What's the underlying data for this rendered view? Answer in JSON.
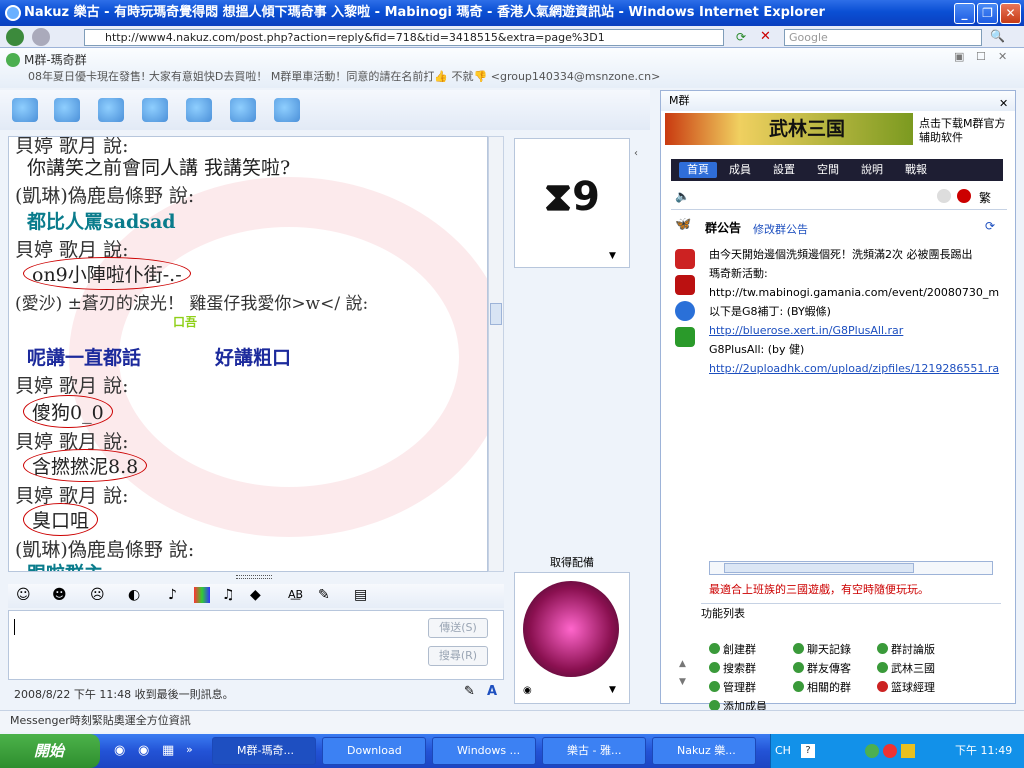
{
  "ie": {
    "title": "Nakuz 樂古 - 有時玩瑪奇覺得悶 想搵人傾下瑪奇事 入黎啦 - Mabinogi 瑪奇 - 香港人氣網遊資訊站 - Windows Internet Explorer",
    "url": "http://www4.nakuz.com/post.php?action=reply&fid=718&tid=3418515&extra=page%3D1",
    "search_placeholder": "Google"
  },
  "messenger": {
    "title": "M群-瑪奇群",
    "subtitle": "08年夏日優卡現在發售! 大家有意姐快D去買啦！ M群單車活動！同意的請在名前打👍 不就👎 <group140334@msnzone.cn>",
    "chat": [
      {
        "kind": "name",
        "text": "貝婷 歌月 說:"
      },
      {
        "kind": "msg",
        "text": "你講笑之前會同人講 我講笑啦?"
      },
      {
        "kind": "name",
        "text": "(凱琳)偽鹿島條野 說:"
      },
      {
        "kind": "msg",
        "text": "都比人罵sadsad"
      },
      {
        "kind": "name",
        "text": "貝婷 歌月 說:"
      },
      {
        "kind": "msg",
        "text": "on9小陣啦仆街-.-"
      },
      {
        "kind": "name",
        "text": "(愛沙) ±蒼刃的淚光！ 雞蛋仔我愛你>w</ 說:"
      },
      {
        "kind": "msg",
        "text": "呢講一直都話"
      },
      {
        "kind": "msg2",
        "text": "好講粗口"
      },
      {
        "kind": "name",
        "text": "貝婷 歌月 說:"
      },
      {
        "kind": "msg",
        "text": "傻狗0_0"
      },
      {
        "kind": "name",
        "text": "貝婷 歌月 說:"
      },
      {
        "kind": "msg",
        "text": "含撚撚泥8.8"
      },
      {
        "kind": "name",
        "text": "貝婷 歌月 說:"
      },
      {
        "kind": "msg",
        "text": "臭口咀"
      },
      {
        "kind": "name",
        "text": "(凱琳)偽鹿島條野 說:"
      },
      {
        "kind": "msg",
        "text": "跟啦群主"
      }
    ],
    "sticker_text": "口吾",
    "send_button": "傳送(S)",
    "search_button": "搜尋(R)",
    "status": "2008/8/22 下午 11:48 收到最後一則訊息。",
    "display_pic_label": "取得配備",
    "footer": "Messenger時刻緊貼奧運全方位資訊"
  },
  "panel": {
    "header": "M群",
    "banner_text": "武林三国",
    "download_text": "点击下载M群官方辅助软件",
    "tabs": [
      "首頁",
      "成員",
      "設置",
      "空間",
      "說明",
      "戰報"
    ],
    "notice_title": "群公告",
    "notice_edit": "修改群公告",
    "notice_lines": [
      {
        "text": "由今天開始邊個洗頻邊個死！洗頻滿2次 必被團長踢出",
        "link": false
      },
      {
        "text": "瑪奇新活動:",
        "link": false
      },
      {
        "text": "http://tw.mabinogi.gamania.com/event/20080730_m",
        "link": false
      },
      {
        "text": "以下是G8補丁: (BY蝦條)",
        "link": false
      },
      {
        "text": "http://bluerose.xert.in/G8PlusAll.rar",
        "link": true
      },
      {
        "text": "G8PlusAll: (by 健)",
        "link": false
      },
      {
        "text": "http://2uploadhk.com/upload/zipfiles/1219286551.ra",
        "link": true
      }
    ],
    "promo": "最適合上班族的三國遊戲，有空時隨便玩玩。",
    "functions_title": "功能列表",
    "functions": [
      "創建群",
      "聊天記錄",
      "群討論版",
      "搜索群",
      "群友傳客",
      "武林三國",
      "管理群",
      "相關的群",
      "篮球經理",
      "添加成員"
    ]
  },
  "taskbar": {
    "start": "開始",
    "tasks": [
      "M群-瑪奇...",
      "Download",
      "Windows ...",
      "樂古 - 雅...",
      "Nakuz 樂..."
    ],
    "lang": "CH",
    "clock": "下午 11:49"
  }
}
